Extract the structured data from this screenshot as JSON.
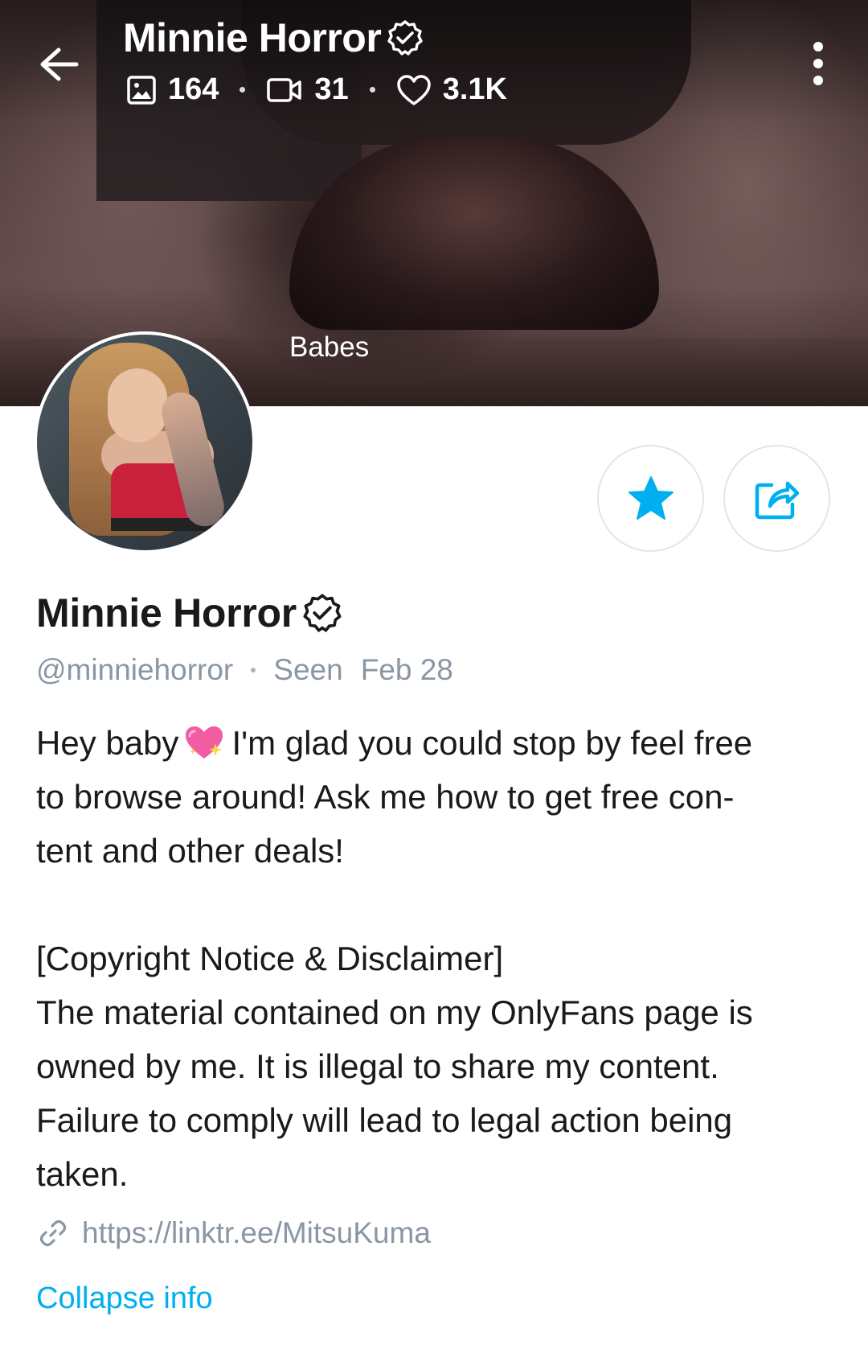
{
  "header": {
    "title": "Minnie Horror",
    "stats": {
      "photos": "164",
      "videos": "31",
      "likes": "3.1K"
    },
    "cover_label": "Babes"
  },
  "profile": {
    "name": "Minnie Horror",
    "handle": "@minniehorror",
    "seen_label": "Seen",
    "seen_date": "Feb 28",
    "bio_lines": {
      "p1a": "Hey baby",
      "p1b": "I'm glad you could stop by feel free",
      "p1c": "to browse around! Ask me how to get free con-",
      "p1d": "tent and other deals!",
      "p2a": "[Copyright Notice & Disclaimer]",
      "p2b": "The material contained on my OnlyFans page is",
      "p2c": "owned by me. It is illegal to share my content.",
      "p2d": "Failure to comply will lead to legal action being",
      "p2e": "taken."
    },
    "link": "https://linktr.ee/MitsuKuma",
    "collapse_label": "Collapse info"
  },
  "icons": {
    "back": "arrow-left-icon",
    "verified": "verified-badge-icon",
    "photo": "image-icon",
    "video": "video-icon",
    "likes": "heart-outline-icon",
    "more": "more-vertical-icon",
    "favorite": "star-icon",
    "share": "share-icon",
    "link": "link-icon",
    "emoji": "sparkling-heart-emoji"
  },
  "colors": {
    "accent": "#00aff0",
    "muted_text": "#8a96a3",
    "text": "#1a1a1a"
  }
}
